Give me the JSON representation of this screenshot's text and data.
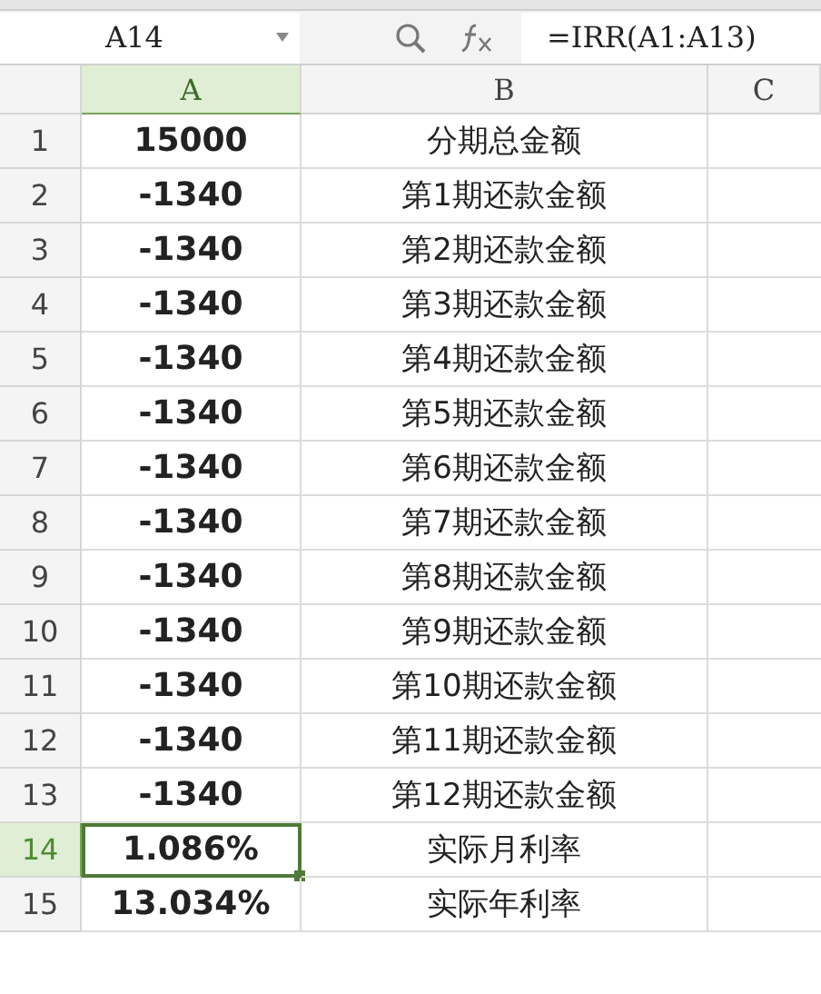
{
  "name_box": {
    "value": "A14"
  },
  "formula_bar": {
    "value": "=IRR(A1:A13)"
  },
  "columns": [
    {
      "label": "A",
      "selected": true
    },
    {
      "label": "B",
      "selected": false
    },
    {
      "label": "C",
      "selected": false
    }
  ],
  "rows": [
    {
      "number": "1",
      "selected": false,
      "a": "15000",
      "b": "分期总金额"
    },
    {
      "number": "2",
      "selected": false,
      "a": "-1340",
      "b": "第1期还款金额"
    },
    {
      "number": "3",
      "selected": false,
      "a": "-1340",
      "b": "第2期还款金额"
    },
    {
      "number": "4",
      "selected": false,
      "a": "-1340",
      "b": "第3期还款金额"
    },
    {
      "number": "5",
      "selected": false,
      "a": "-1340",
      "b": "第4期还款金额"
    },
    {
      "number": "6",
      "selected": false,
      "a": "-1340",
      "b": "第5期还款金额"
    },
    {
      "number": "7",
      "selected": false,
      "a": "-1340",
      "b": "第6期还款金额"
    },
    {
      "number": "8",
      "selected": false,
      "a": "-1340",
      "b": "第7期还款金额"
    },
    {
      "number": "9",
      "selected": false,
      "a": "-1340",
      "b": "第8期还款金额"
    },
    {
      "number": "10",
      "selected": false,
      "a": "-1340",
      "b": "第9期还款金额"
    },
    {
      "number": "11",
      "selected": false,
      "a": "-1340",
      "b": "第10期还款金额"
    },
    {
      "number": "12",
      "selected": false,
      "a": "-1340",
      "b": "第11期还款金额"
    },
    {
      "number": "13",
      "selected": false,
      "a": "-1340",
      "b": "第12期还款金额"
    },
    {
      "number": "14",
      "selected": true,
      "a": "1.086%",
      "b": "实际月利率"
    },
    {
      "number": "15",
      "selected": false,
      "a": "13.034%",
      "b": "实际年利率"
    }
  ]
}
